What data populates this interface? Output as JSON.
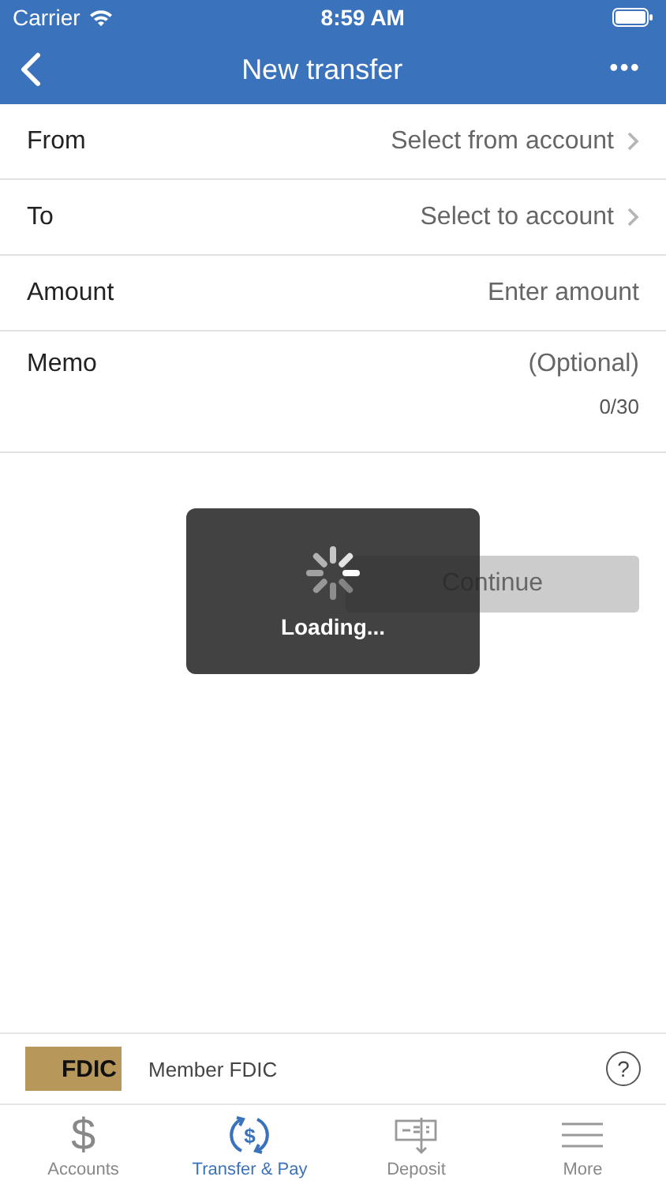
{
  "status_bar": {
    "carrier": "Carrier",
    "time": "8:59 AM"
  },
  "nav": {
    "title": "New transfer",
    "menu": "•••"
  },
  "fields": [
    {
      "label": "From",
      "value": "Select from account",
      "chevron": true
    },
    {
      "label": "To",
      "value": "Select to account",
      "chevron": true
    },
    {
      "label": "Amount",
      "placeholder": "Enter amount",
      "chevron": false
    },
    {
      "label": "Memo",
      "placeholder": "(Optional)",
      "counter": "0/30",
      "chevron": false
    }
  ],
  "continue_button": {
    "label": "Continue",
    "disabled": true
  },
  "loading": {
    "text": "Loading..."
  },
  "footer": {
    "logo": "FDIC",
    "text": "Member FDIC",
    "help": "?"
  },
  "tabs": [
    {
      "label": "Accounts",
      "kind": "dollar",
      "glyph": "$",
      "selected": false
    },
    {
      "label": "Transfer & Pay",
      "kind": "transfer",
      "glyph": "$",
      "selected": true
    },
    {
      "label": "Deposit",
      "kind": "deposit",
      "selected": false
    },
    {
      "label": "More",
      "kind": "more",
      "selected": false
    }
  ]
}
